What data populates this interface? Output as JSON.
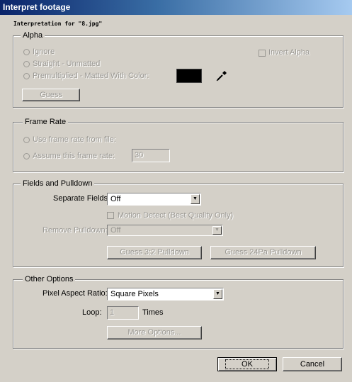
{
  "window": {
    "title": "Interpret footage"
  },
  "interpretation_label": "Interpretation for \"8.jpg\"",
  "alpha": {
    "legend": "Alpha",
    "ignore": "Ignore",
    "straight": "Straight - Unmatted",
    "premultiplied": "Premultiplied - Matted With Color:",
    "invert_alpha": "Invert Alpha",
    "guess": "Guess",
    "matte_color": "#000000"
  },
  "frame_rate": {
    "legend": "Frame Rate",
    "use_file": "Use frame rate from file:",
    "assume": "Assume this frame rate:",
    "value": "30"
  },
  "fields": {
    "legend": "Fields and Pulldown",
    "separate_label": "Separate Fields:",
    "separate_value": "Off",
    "motion_detect": "Motion Detect (Best Quality Only)",
    "remove_label": "Remove Pulldown:",
    "remove_value": "Off",
    "guess32": "Guess 3:2 Pulldown",
    "guess24": "Guess 24Pa Pulldown"
  },
  "other": {
    "legend": "Other Options",
    "par_label": "Pixel Aspect Ratio:",
    "par_value": "Square Pixels",
    "loop_label": "Loop:",
    "loop_value": "1",
    "times": "Times",
    "more": "More Options..."
  },
  "buttons": {
    "ok": "OK",
    "cancel": "Cancel"
  }
}
